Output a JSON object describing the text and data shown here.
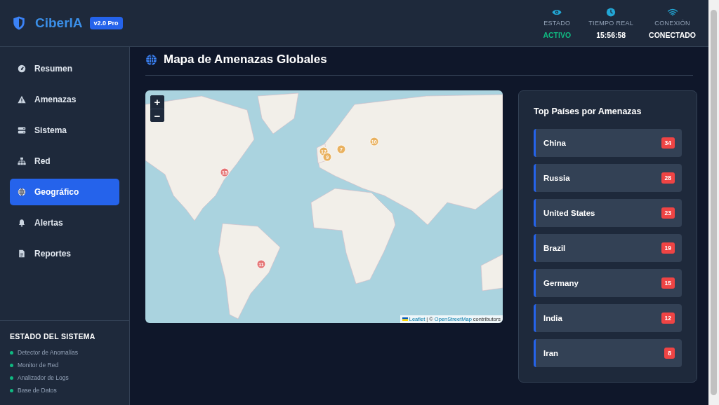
{
  "header": {
    "brand": "CiberIA",
    "version_badge": "v2.0 Pro",
    "status": [
      {
        "kind": "eye",
        "label": "ESTADO",
        "value": "ACTIVO",
        "highlight": true
      },
      {
        "kind": "clock",
        "label": "TIEMPO REAL",
        "value": "15:56:58",
        "highlight": false
      },
      {
        "kind": "wifi",
        "label": "CONEXIÓN",
        "value": "CONECTADO",
        "highlight": false
      }
    ]
  },
  "sidebar": {
    "items": [
      {
        "kind": "gauge",
        "label": "Resumen",
        "selected": false
      },
      {
        "kind": "warning",
        "label": "Amenazas",
        "selected": false
      },
      {
        "kind": "server",
        "label": "Sistema",
        "selected": false
      },
      {
        "kind": "network",
        "label": "Red",
        "selected": false
      },
      {
        "kind": "globe",
        "label": "Geográfico",
        "selected": true
      },
      {
        "kind": "bell",
        "label": "Alertas",
        "selected": false
      },
      {
        "kind": "file",
        "label": "Reportes",
        "selected": false
      }
    ],
    "system_status": {
      "title": "ESTADO DEL SISTEMA",
      "services": [
        {
          "name": "Detector de Anomalías",
          "color": "#10b981"
        },
        {
          "name": "Monitor de Red",
          "color": "#10b981"
        },
        {
          "name": "Analizador de Logs",
          "color": "#10b981"
        },
        {
          "name": "Base de Datos",
          "color": "#10b981"
        }
      ]
    }
  },
  "main": {
    "title": "Mapa de Amenazas Globales",
    "map": {
      "zoom_in": "+",
      "zoom_out": "−",
      "markers": [
        {
          "label": "15",
          "color": "#e57373"
        },
        {
          "label": "17",
          "color": "#e9b15f"
        },
        {
          "label": "9",
          "color": "#e9b15f"
        },
        {
          "label": "7",
          "color": "#e9b15f"
        },
        {
          "label": "10",
          "color": "#e9b15f"
        },
        {
          "label": "11",
          "color": "#e57373"
        }
      ],
      "attribution": {
        "leaflet": "Leaflet",
        "separator": "| ©",
        "osm": "OpenStreetMap",
        "suffix": "contributors"
      }
    },
    "top_countries": {
      "title": "Top Países por Amenazas",
      "items": [
        {
          "country": "China",
          "count": "34"
        },
        {
          "country": "Russia",
          "count": "28"
        },
        {
          "country": "United States",
          "count": "23"
        },
        {
          "country": "Brazil",
          "count": "19"
        },
        {
          "country": "Germany",
          "count": "15"
        },
        {
          "country": "India",
          "count": "12"
        },
        {
          "country": "Iran",
          "count": "8"
        }
      ]
    }
  }
}
